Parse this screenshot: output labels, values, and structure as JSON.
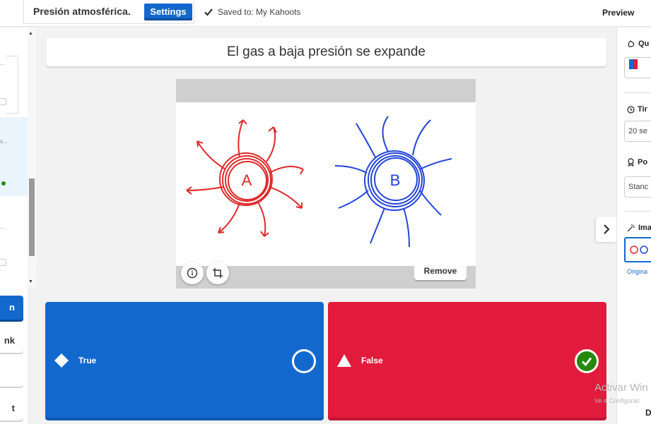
{
  "header": {
    "title": "Presión atmosférica.",
    "settings_label": "Settings",
    "saved_text": "Saved to: My Kahoots",
    "preview_label": "Preview"
  },
  "sidebar": {
    "slide_dots": [
      "...",
      "s...",
      "..."
    ],
    "buttons": [
      {
        "label": "n"
      },
      {
        "label": "nk"
      },
      {
        "label": ""
      },
      {
        "label": "t"
      }
    ]
  },
  "question": {
    "text": "El gas a baja presión se expande",
    "image_labels": [
      "A",
      "B"
    ],
    "remove_label": "Remove"
  },
  "answers": [
    {
      "label": "True",
      "shape": "diamond-icon",
      "color": "#1368ce",
      "correct": false
    },
    {
      "label": "False",
      "shape": "triangle-icon",
      "color": "#e21b3c",
      "correct": true
    }
  ],
  "right_panel": {
    "question_type_heading": "Qu",
    "time_limit_heading": "Tir",
    "time_limit_value": "20 se",
    "points_heading": "Po",
    "points_value": "Stanc",
    "image_heading": "Ima",
    "original_link": "Origina",
    "bottom_label": "D"
  },
  "watermark": {
    "line1": "Activar Win",
    "line2": "Ve a Configurac"
  }
}
